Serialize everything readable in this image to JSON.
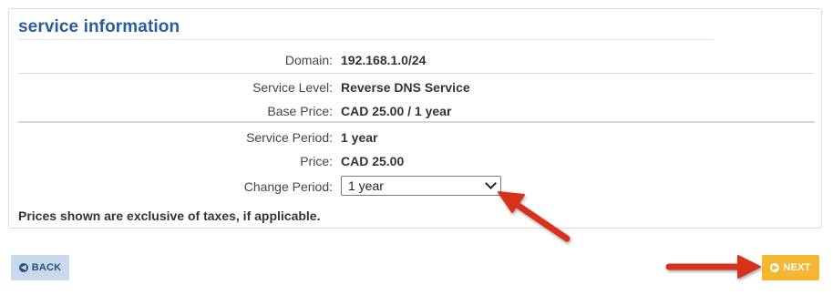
{
  "section": {
    "title": "service information"
  },
  "fields": [
    {
      "label": "Domain:",
      "value": "192.168.1.0/24"
    },
    {
      "label": "Service Level:",
      "value": "Reverse DNS Service"
    },
    {
      "label": "Base Price:",
      "value": "CAD 25.00 / 1 year"
    },
    {
      "label": "Service Period:",
      "value": "1 year"
    },
    {
      "label": "Price:",
      "value": "CAD 25.00"
    }
  ],
  "change_period": {
    "label": "Change Period:",
    "selected": "1 year"
  },
  "note": "Prices shown are exclusive of taxes, if applicable.",
  "buttons": {
    "back": "BACK",
    "next": "NEXT"
  },
  "colors": {
    "title": "#2a5d9f",
    "next": "#f4b731",
    "back": "#c9d9ec",
    "annotation_arrow": "#d9301e"
  }
}
